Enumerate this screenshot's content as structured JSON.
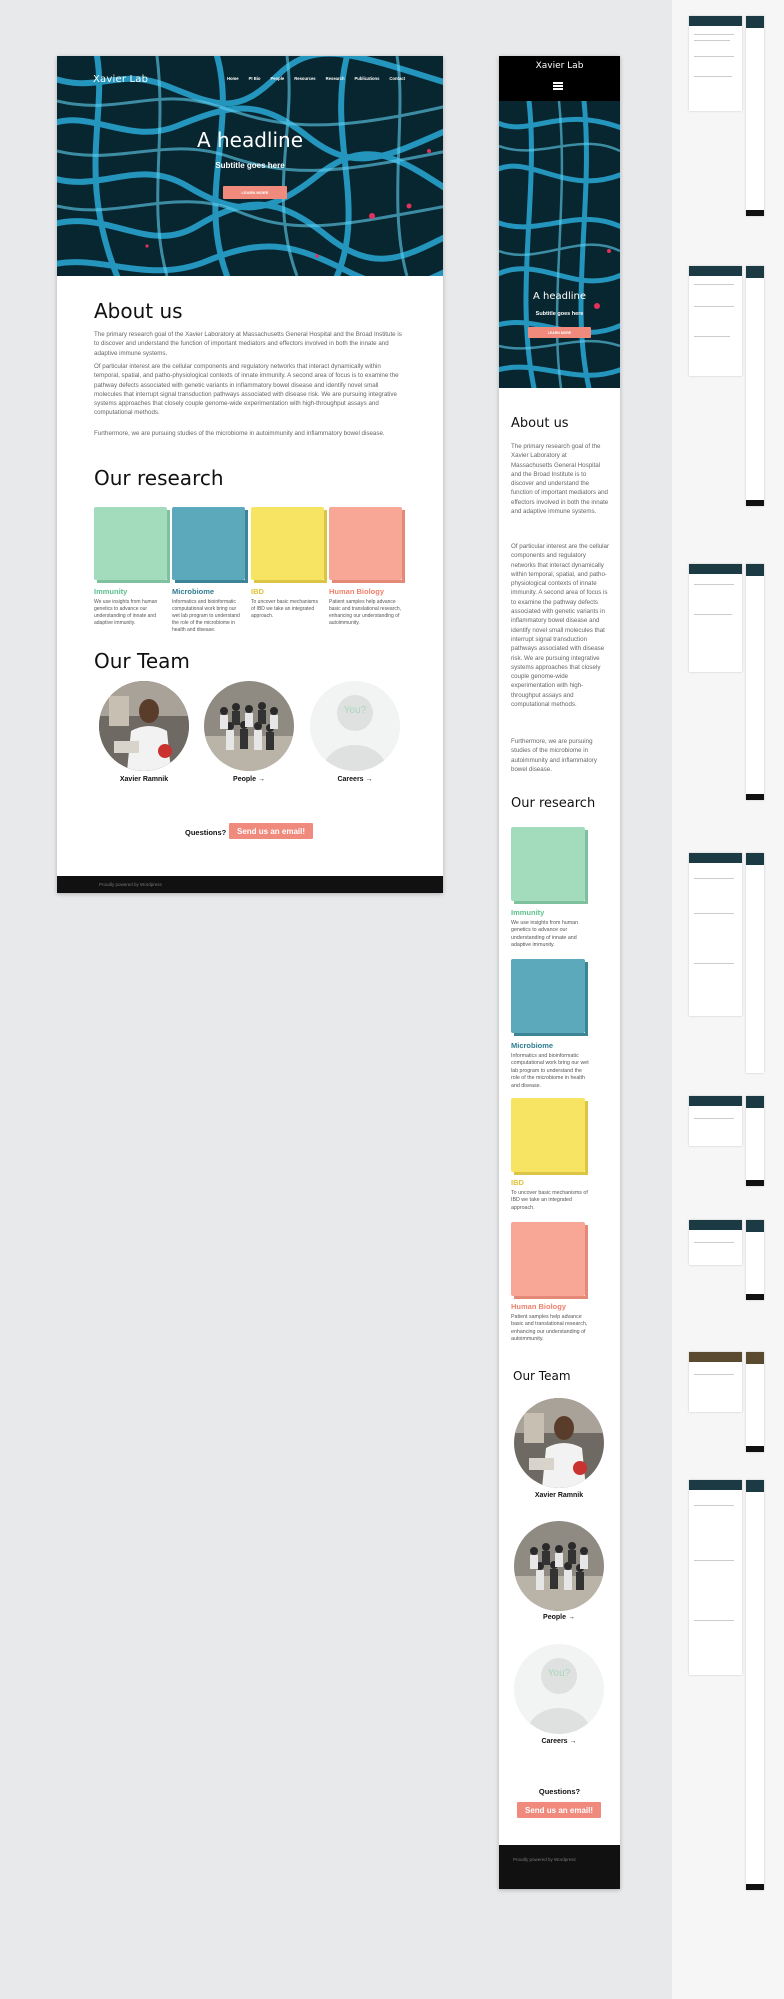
{
  "brand": "Xavier Lab",
  "nav": [
    "Home",
    "PI Bio",
    "People",
    "Resources",
    "Research",
    "Publications",
    "Contact"
  ],
  "hero": {
    "title": "A headline",
    "subtitle": "Subtitle goes here",
    "button": "LEARN MORE"
  },
  "about": {
    "heading": "About us",
    "paragraphs": [
      "The primary research goal of the Xavier Laboratory at Massachusetts General Hospital and the Broad Institute is to discover and understand the function of important mediators and effectors involved in both the innate and adaptive immune systems.",
      "Of particular interest are the cellular components and regulatory networks that interact dynamically within temporal, spatial, and patho-physiological contexts of innate immunity. A second area of focus is to examine the pathway defects associated with genetic variants in inflammatory bowel disease and identify novel small molecules that interrupt signal transduction pathways associated with disease risk. We are pursuing integrative systems approaches that closely couple genome-wide experimentation with high-throughput assays and computational methods.",
      "Furthermore, we are pursuing studies of the microbiome in autoimmunity and inflammatory bowel disease."
    ]
  },
  "research": {
    "heading": "Our research",
    "items": [
      {
        "label": "Immunity",
        "text": "We use insights from human genetics to advance our understanding of innate and adaptive immunity.",
        "color": "#a3dcbd",
        "side": "#7fc19c",
        "labelColor": "#5dbf8d"
      },
      {
        "label": "Microbiome",
        "text": "Informatics and bioinformatic computational work bring our wet lab program to understand the role of the microbiome in health and disease.",
        "color": "#5ba9bb",
        "side": "#3c8496",
        "labelColor": "#2f7d91"
      },
      {
        "label": "IBD",
        "text": "To uncover basic mechanisms of IBD we take an integrated approach.",
        "color": "#f8e463",
        "side": "#dcc444",
        "labelColor": "#e2c23a"
      },
      {
        "label": "Human Biology",
        "text": "Patient samples help advance basic and translational research, enhancing our understanding of autoimmunity.",
        "color": "#f8a797",
        "side": "#e48878",
        "labelColor": "#ef7f6c"
      }
    ]
  },
  "team": {
    "heading": "Our Team",
    "members": [
      {
        "label": "Xavier Ramnik"
      },
      {
        "label": "People →"
      },
      {
        "label": "Careers →"
      }
    ],
    "placeholder": "You?"
  },
  "contact": {
    "question": "Questions?",
    "button": "Send us an email!"
  },
  "footer": "Proudly powered by Wordpress",
  "colors": {
    "accent": "#f08a7c",
    "footer": "#111111",
    "background": "#e8e9ea"
  }
}
